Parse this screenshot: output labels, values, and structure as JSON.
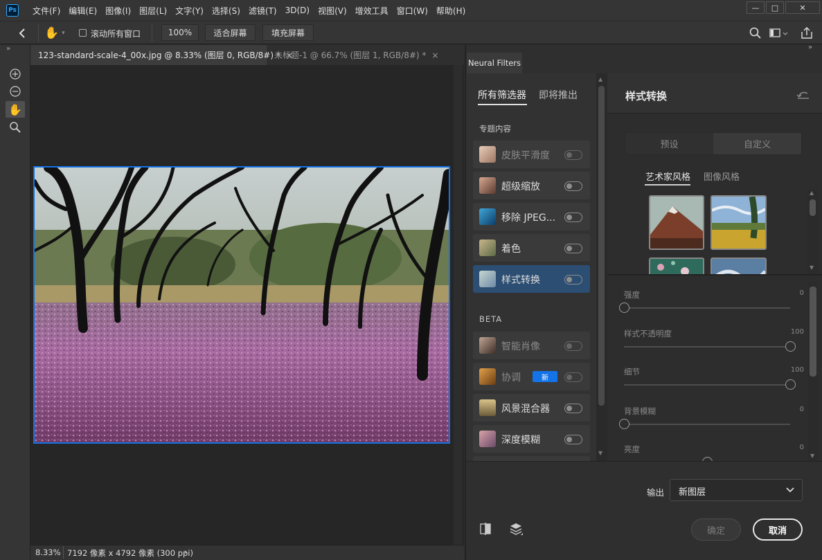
{
  "app": {
    "logo": "Ps"
  },
  "menu": [
    "文件(F)",
    "编辑(E)",
    "图像(I)",
    "图层(L)",
    "文字(Y)",
    "选择(S)",
    "滤镜(T)",
    "3D(D)",
    "视图(V)",
    "增效工具",
    "窗口(W)",
    "帮助(H)"
  ],
  "options": {
    "scroll_all": "滚动所有窗口",
    "zoom": "100%",
    "fit_screen": "适合屏幕",
    "fill_screen": "填充屏幕"
  },
  "tabs": [
    {
      "label": "123-standard-scale-4_00x.jpg @ 8.33% (图层 0, RGB/8#) *",
      "close": "×"
    },
    {
      "label": "未标题-1 @ 66.7% (图层 1, RGB/8#) *",
      "close": "×"
    }
  ],
  "status": {
    "zoom": "8.33%",
    "info": "7192 像素 x 4792 像素 (300 ppi)",
    "arrow": "›"
  },
  "panel": {
    "tab": "Neural Filters",
    "cat_all": "所有筛选器",
    "cat_coming": "即将推出",
    "featured_header": "专题内容",
    "beta_header": "BETA",
    "new_badge": "新",
    "featured": [
      {
        "label": "皮肤平滑度",
        "enabled": false
      },
      {
        "label": "超级缩放",
        "enabled": true
      },
      {
        "label": "移除 JPEG...",
        "enabled": true
      },
      {
        "label": "着色",
        "enabled": true
      },
      {
        "label": "样式转换",
        "enabled": true,
        "selected": true
      }
    ],
    "beta": [
      {
        "label": "智能肖像",
        "enabled": false
      },
      {
        "label": "协调",
        "enabled": false,
        "badge": true
      },
      {
        "label": "风景混合器",
        "enabled": true
      },
      {
        "label": "深度模糊",
        "enabled": true
      }
    ]
  },
  "style": {
    "title": "样式转换",
    "seg_preset": "预设",
    "seg_custom": "自定义",
    "tab_artist": "艺术家风格",
    "tab_image": "图像风格",
    "sliders": [
      {
        "label": "强度",
        "value": "0",
        "fraction": 0
      },
      {
        "label": "样式不透明度",
        "value": "100",
        "fraction": 1
      },
      {
        "label": "细节",
        "value": "100",
        "fraction": 1
      },
      {
        "label": "背景模糊",
        "value": "0",
        "fraction": 0
      },
      {
        "label": "亮度",
        "value": "0",
        "fraction": 0.5
      }
    ]
  },
  "output": {
    "label": "输出",
    "value": "新图层"
  },
  "buttons": {
    "ok": "确定",
    "cancel": "取消"
  }
}
